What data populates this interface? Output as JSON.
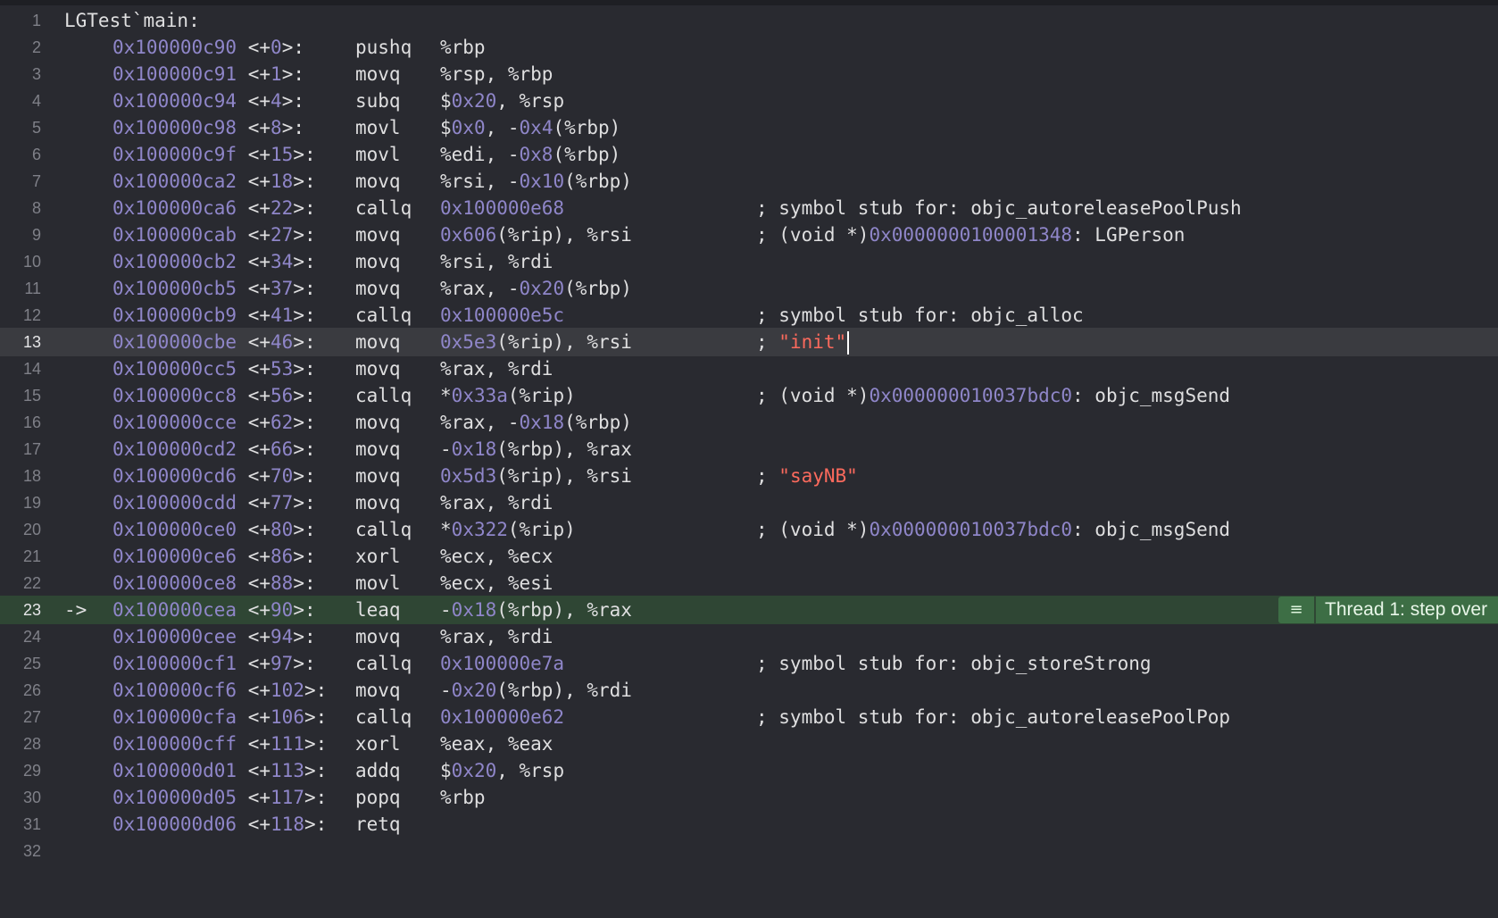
{
  "editor": {
    "title_line": "LGTest`main:",
    "pc_arrow": "->",
    "current_line": 13,
    "pc_line": 23,
    "thread_badge": {
      "icon": "list-icon",
      "icon_glyph": "≡",
      "label": "Thread 1: step over"
    },
    "line_numbers": [
      "1",
      "2",
      "3",
      "4",
      "5",
      "6",
      "7",
      "8",
      "9",
      "10",
      "11",
      "12",
      "13",
      "14",
      "15",
      "16",
      "17",
      "18",
      "19",
      "20",
      "21",
      "22",
      "23",
      "24",
      "25",
      "26",
      "27",
      "28",
      "29",
      "30",
      "31",
      "32"
    ],
    "instructions": [
      {
        "addr": "0x100000c90",
        "off": "<+0>:",
        "op": "pushq",
        "args": "%rbp",
        "comment": ""
      },
      {
        "addr": "0x100000c91",
        "off": "<+1>:",
        "op": "movq",
        "args": "%rsp, %rbp",
        "comment": ""
      },
      {
        "addr": "0x100000c94",
        "off": "<+4>:",
        "op": "subq",
        "args": "$0x20, %rsp",
        "comment": ""
      },
      {
        "addr": "0x100000c98",
        "off": "<+8>:",
        "op": "movl",
        "args": "$0x0, -0x4(%rbp)",
        "comment": ""
      },
      {
        "addr": "0x100000c9f",
        "off": "<+15>:",
        "op": "movl",
        "args": "%edi, -0x8(%rbp)",
        "comment": ""
      },
      {
        "addr": "0x100000ca2",
        "off": "<+18>:",
        "op": "movq",
        "args": "%rsi, -0x10(%rbp)",
        "comment": ""
      },
      {
        "addr": "0x100000ca6",
        "off": "<+22>:",
        "op": "callq",
        "args": "0x100000e68",
        "comment": "; symbol stub for: objc_autoreleasePoolPush"
      },
      {
        "addr": "0x100000cab",
        "off": "<+27>:",
        "op": "movq",
        "args": "0x606(%rip), %rsi",
        "comment": "; (void *)0x0000000100001348: LGPerson"
      },
      {
        "addr": "0x100000cb2",
        "off": "<+34>:",
        "op": "movq",
        "args": "%rsi, %rdi",
        "comment": ""
      },
      {
        "addr": "0x100000cb5",
        "off": "<+37>:",
        "op": "movq",
        "args": "%rax, -0x20(%rbp)",
        "comment": ""
      },
      {
        "addr": "0x100000cb9",
        "off": "<+41>:",
        "op": "callq",
        "args": "0x100000e5c",
        "comment": "; symbol stub for: objc_alloc"
      },
      {
        "addr": "0x100000cbe",
        "off": "<+46>:",
        "op": "movq",
        "args": "0x5e3(%rip), %rsi",
        "comment": "; \"init\""
      },
      {
        "addr": "0x100000cc5",
        "off": "<+53>:",
        "op": "movq",
        "args": "%rax, %rdi",
        "comment": ""
      },
      {
        "addr": "0x100000cc8",
        "off": "<+56>:",
        "op": "callq",
        "args": "*0x33a(%rip)",
        "comment": "; (void *)0x000000010037bdc0: objc_msgSend"
      },
      {
        "addr": "0x100000cce",
        "off": "<+62>:",
        "op": "movq",
        "args": "%rax, -0x18(%rbp)",
        "comment": ""
      },
      {
        "addr": "0x100000cd2",
        "off": "<+66>:",
        "op": "movq",
        "args": "-0x18(%rbp), %rax",
        "comment": ""
      },
      {
        "addr": "0x100000cd6",
        "off": "<+70>:",
        "op": "movq",
        "args": "0x5d3(%rip), %rsi",
        "comment": "; \"sayNB\""
      },
      {
        "addr": "0x100000cdd",
        "off": "<+77>:",
        "op": "movq",
        "args": "%rax, %rdi",
        "comment": ""
      },
      {
        "addr": "0x100000ce0",
        "off": "<+80>:",
        "op": "callq",
        "args": "*0x322(%rip)",
        "comment": "; (void *)0x000000010037bdc0: objc_msgSend"
      },
      {
        "addr": "0x100000ce6",
        "off": "<+86>:",
        "op": "xorl",
        "args": "%ecx, %ecx",
        "comment": ""
      },
      {
        "addr": "0x100000ce8",
        "off": "<+88>:",
        "op": "movl",
        "args": "%ecx, %esi",
        "comment": ""
      },
      {
        "addr": "0x100000cea",
        "off": "<+90>:",
        "op": "leaq",
        "args": "-0x18(%rbp), %rax",
        "comment": ""
      },
      {
        "addr": "0x100000cee",
        "off": "<+94>:",
        "op": "movq",
        "args": "%rax, %rdi",
        "comment": ""
      },
      {
        "addr": "0x100000cf1",
        "off": "<+97>:",
        "op": "callq",
        "args": "0x100000e7a",
        "comment": "; symbol stub for: objc_storeStrong"
      },
      {
        "addr": "0x100000cf6",
        "off": "<+102>:",
        "op": "movq",
        "args": "-0x20(%rbp), %rdi",
        "comment": ""
      },
      {
        "addr": "0x100000cfa",
        "off": "<+106>:",
        "op": "callq",
        "args": "0x100000e62",
        "comment": "; symbol stub for: objc_autoreleasePoolPop"
      },
      {
        "addr": "0x100000cff",
        "off": "<+111>:",
        "op": "xorl",
        "args": "%eax, %eax",
        "comment": ""
      },
      {
        "addr": "0x100000d01",
        "off": "<+113>:",
        "op": "addq",
        "args": "$0x20, %rsp",
        "comment": ""
      },
      {
        "addr": "0x100000d05",
        "off": "<+117>:",
        "op": "popq",
        "args": "%rbp",
        "comment": ""
      },
      {
        "addr": "0x100000d06",
        "off": "<+118>:",
        "op": "retq",
        "args": "",
        "comment": ""
      }
    ]
  },
  "colors": {
    "background": "#292a30",
    "current_line": "#3a3b40",
    "pc_line": "#2f4634",
    "badge": "#3d6e45",
    "text": "#dfdfe0",
    "number": "#8f86c9",
    "string": "#fc6a5d",
    "gutter": "#7f8088"
  }
}
